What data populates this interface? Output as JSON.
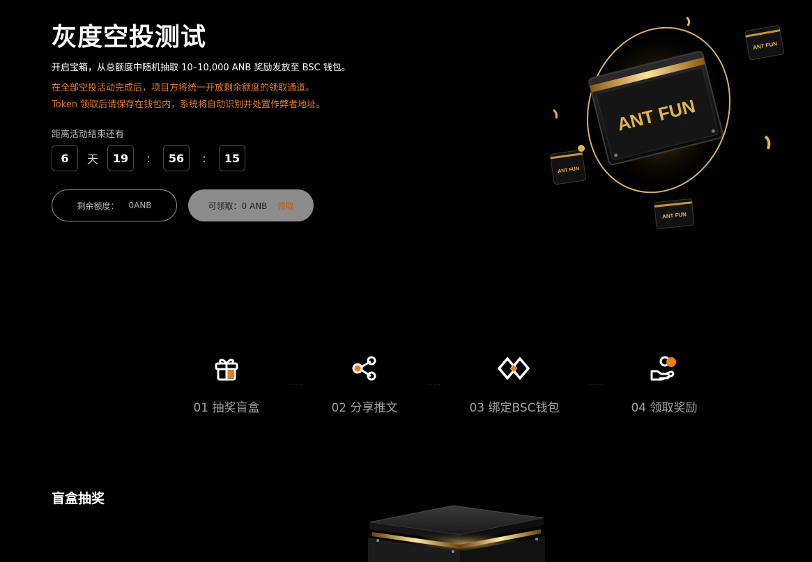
{
  "header": {
    "title": "灰度空投测试",
    "description": "开启宝箱，从总额度中随机抽取 10–10,000 ANB 奖励发放至 BSC 钱包。",
    "warning_1": "在全部空投活动完成后，项目方将统一开放剩余额度的领取通道。",
    "warning_2": "Token 领取后请保存在钱包内，系统将自动识别并处置作弊者地址。"
  },
  "countdown": {
    "label": "距离活动结束还有",
    "days": "6",
    "days_unit": "天",
    "hours": "19",
    "minutes": "56",
    "seconds": "15",
    "separator": ":"
  },
  "balance": {
    "remaining_label": "剩余额度：",
    "remaining_value": "0ANB",
    "claimable_label": "可领取：0 ANB",
    "claim_button": "领取"
  },
  "hero": {
    "brand_big": "ANT FUN",
    "brand_small": "ANT FUN"
  },
  "steps": [
    {
      "label": "01 抽奖盲盒",
      "icon": "gift-icon"
    },
    {
      "label": "02 分享推文",
      "icon": "share-icon"
    },
    {
      "label": "03 绑定BSC钱包",
      "icon": "bsc-icon"
    },
    {
      "label": "04 领取奖励",
      "icon": "hand-coin-icon"
    }
  ],
  "section": {
    "blind_box_title": "盲盒抽奖"
  },
  "colors": {
    "background": "#000000",
    "accent_orange": "#e8782a",
    "gold": "#e0b04a",
    "muted_text": "#a0a0a0"
  }
}
